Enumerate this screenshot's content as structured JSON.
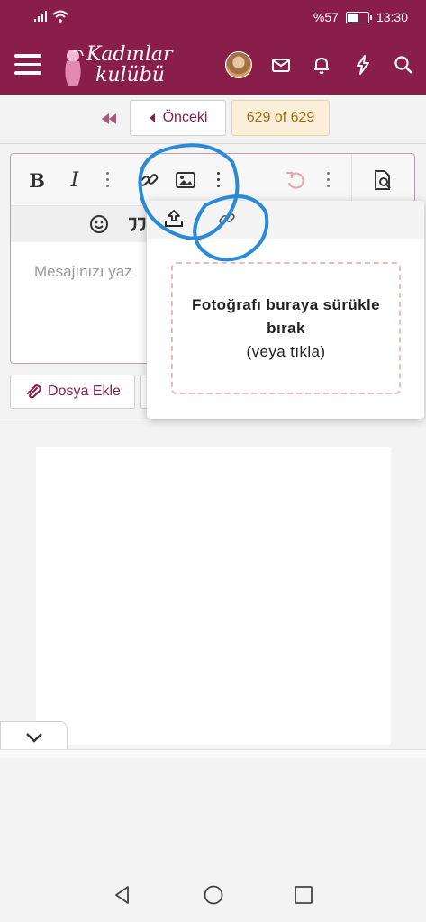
{
  "status_bar": {
    "battery_text": "%57",
    "time": "13:30",
    "battery_level": 0.57
  },
  "app_bar": {
    "logo_line1": "Kadınlar",
    "logo_line2": "kulübü"
  },
  "pager": {
    "prev_label": "Önceki",
    "page_count": "629 of 629"
  },
  "editor": {
    "placeholder": "Mesajınızı yaz"
  },
  "image_popup": {
    "drop_line1": "Fotoğrafı buraya sürükle",
    "drop_line2": "bırak",
    "drop_line3": "(veya tıkla)"
  },
  "attach_button": {
    "label": "Dosya Ekle"
  },
  "colors": {
    "brand": "#8a1e4a",
    "annotation": "#2a8ad8",
    "page_badge_bg": "#fcefd9",
    "drop_border": "#f0b8b8"
  }
}
